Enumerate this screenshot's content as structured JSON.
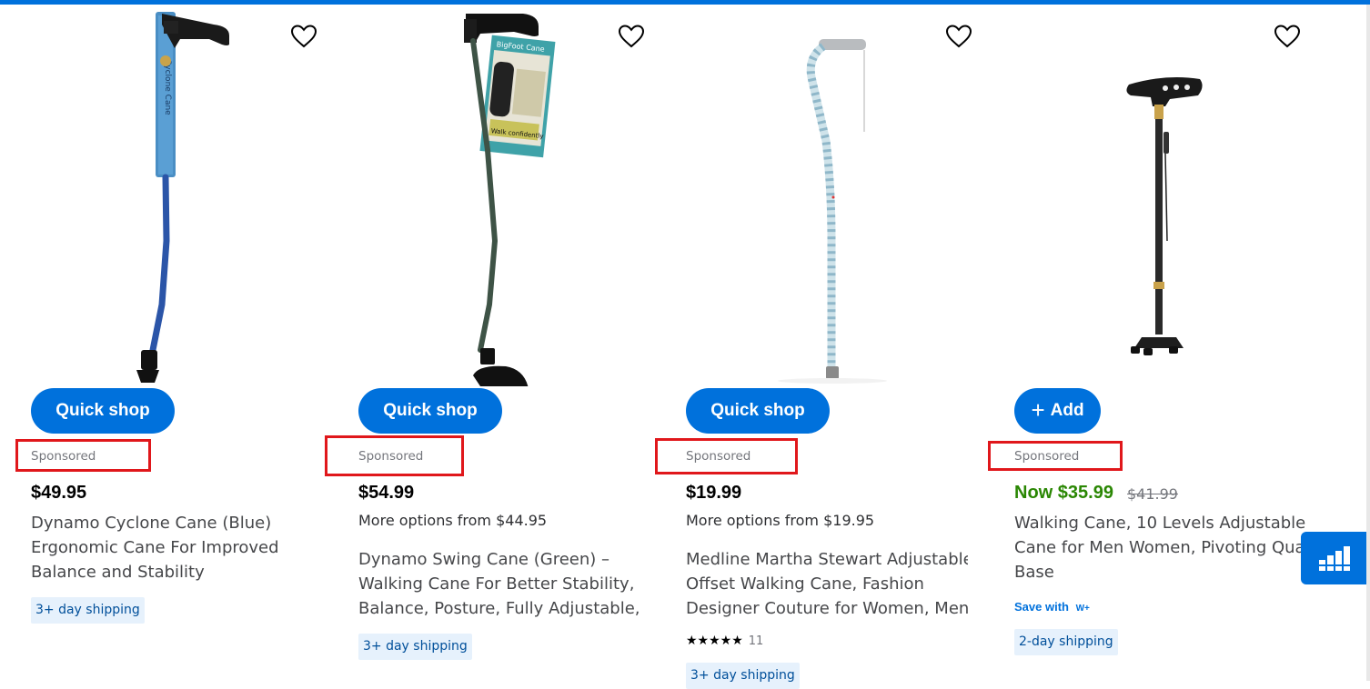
{
  "colors": {
    "brand": "#0071dc",
    "sponsor_highlight": "#e0171b",
    "sale_price": "#2a8703",
    "ship_badge_bg": "#e6f1fc"
  },
  "products": [
    {
      "image_icon": "blue-cane-image",
      "action_label": "Quick shop",
      "sponsored": "Sponsored",
      "price": "$49.95",
      "title_lines": [
        "Dynamo Cyclone Cane (Blue)",
        "Ergonomic Cane For Improved",
        "Balance and Stability"
      ],
      "shipping": "3+ day shipping"
    },
    {
      "image_icon": "green-cane-image",
      "action_label": "Quick shop",
      "sponsored": "Sponsored",
      "price": "$54.99",
      "more_options": "More options from $44.95",
      "title_lines": [
        "Dynamo Swing Cane (Green) –",
        "Walking Cane For Better Stability,",
        "Balance, Posture, Fully Adjustable,..."
      ],
      "shipping": "3+ day shipping"
    },
    {
      "image_icon": "offset-cane-image",
      "action_label": "Quick shop",
      "sponsored": "Sponsored",
      "price": "$19.99",
      "more_options": "More options from $19.95",
      "title_lines": [
        "Medline Martha Stewart Adjustable",
        "Offset Walking Cane, Fashion",
        "Designer Couture for Women, Men..."
      ],
      "rating_stars": "★★★★★",
      "rating_count": "11",
      "shipping": "3+ day shipping"
    },
    {
      "image_icon": "quad-cane-image",
      "action_label": "Add",
      "sponsored": "Sponsored",
      "price": "Now $35.99",
      "was_price": "$41.99",
      "title_lines": [
        "Walking Cane, 10 Levels Adjustable",
        "Cane for Men Women, Pivoting Quad",
        "Base"
      ],
      "save_with": "Save with",
      "save_with_brand": "W+",
      "shipping": "2-day shipping"
    }
  ]
}
